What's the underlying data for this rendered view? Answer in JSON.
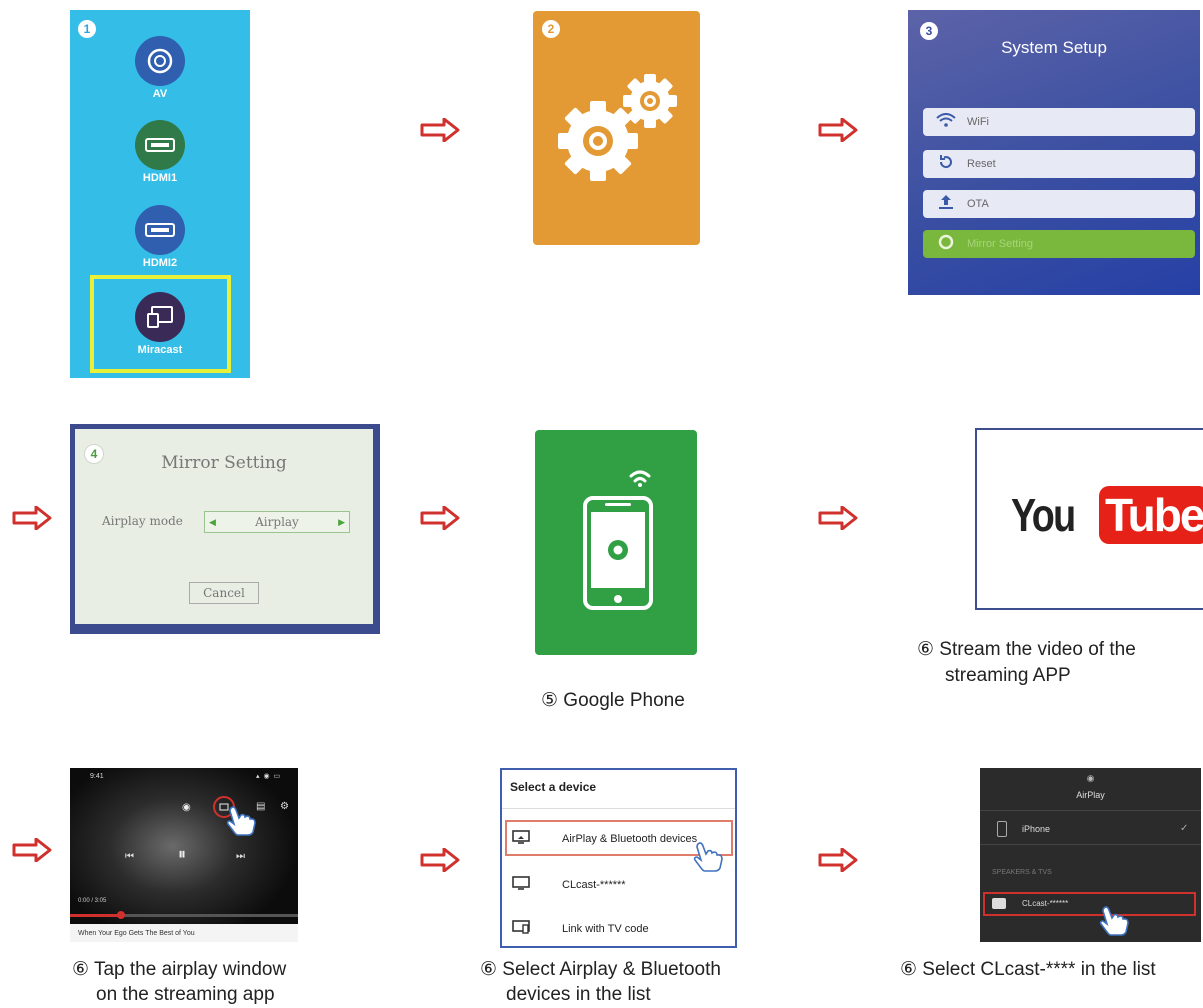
{
  "steps": {
    "s1": "1",
    "s2": "2",
    "s3": "3",
    "s4": "4"
  },
  "inputs": {
    "av": "AV",
    "hdmi1": "HDMI1",
    "hdmi2": "HDMI2",
    "miracast": "Miracast"
  },
  "system_setup": {
    "title": "System Setup",
    "items": [
      "WiFi",
      "Reset",
      "OTA",
      "Mirror Setting"
    ]
  },
  "mirror_setting": {
    "title": "Mirror Setting",
    "mode_label": "Airplay mode",
    "mode_value": "Airplay",
    "cancel": "Cancel"
  },
  "youtube": {
    "you": "You",
    "tube": "Tube"
  },
  "streaming_app": {
    "time": "9:41",
    "video_time": "0:00 / 3:05",
    "video_title": "When Your Ego Gets The Best of You"
  },
  "select_device": {
    "title": "Select a device",
    "items": [
      "AirPlay & Bluetooth devices",
      "CLcast-******",
      "Link with TV code"
    ]
  },
  "airplay_menu": {
    "title": "AirPlay",
    "iphone": "iPhone",
    "section": "SPEAKERS & TVS",
    "device": "CLcast-******"
  },
  "captions": {
    "google_phone": "⑤ Google Phone",
    "stream_1": "⑥ Stream the video of the",
    "stream_2": "streaming APP",
    "tap_1": "⑥ Tap the airplay window",
    "tap_2": "on the streaming app",
    "select_1": "⑥ Select Airplay & Bluetooth",
    "select_2": "devices in the list",
    "clcast": "⑥ Select CLcast-**** in the list"
  },
  "colors": {
    "arrow": "#d0312d",
    "miracast_highlight": "#e8f038",
    "input_panel": "#34bde6",
    "settings_tile": "#e39a34",
    "phone_tile": "#31a044",
    "youtube_red": "#e62117"
  }
}
